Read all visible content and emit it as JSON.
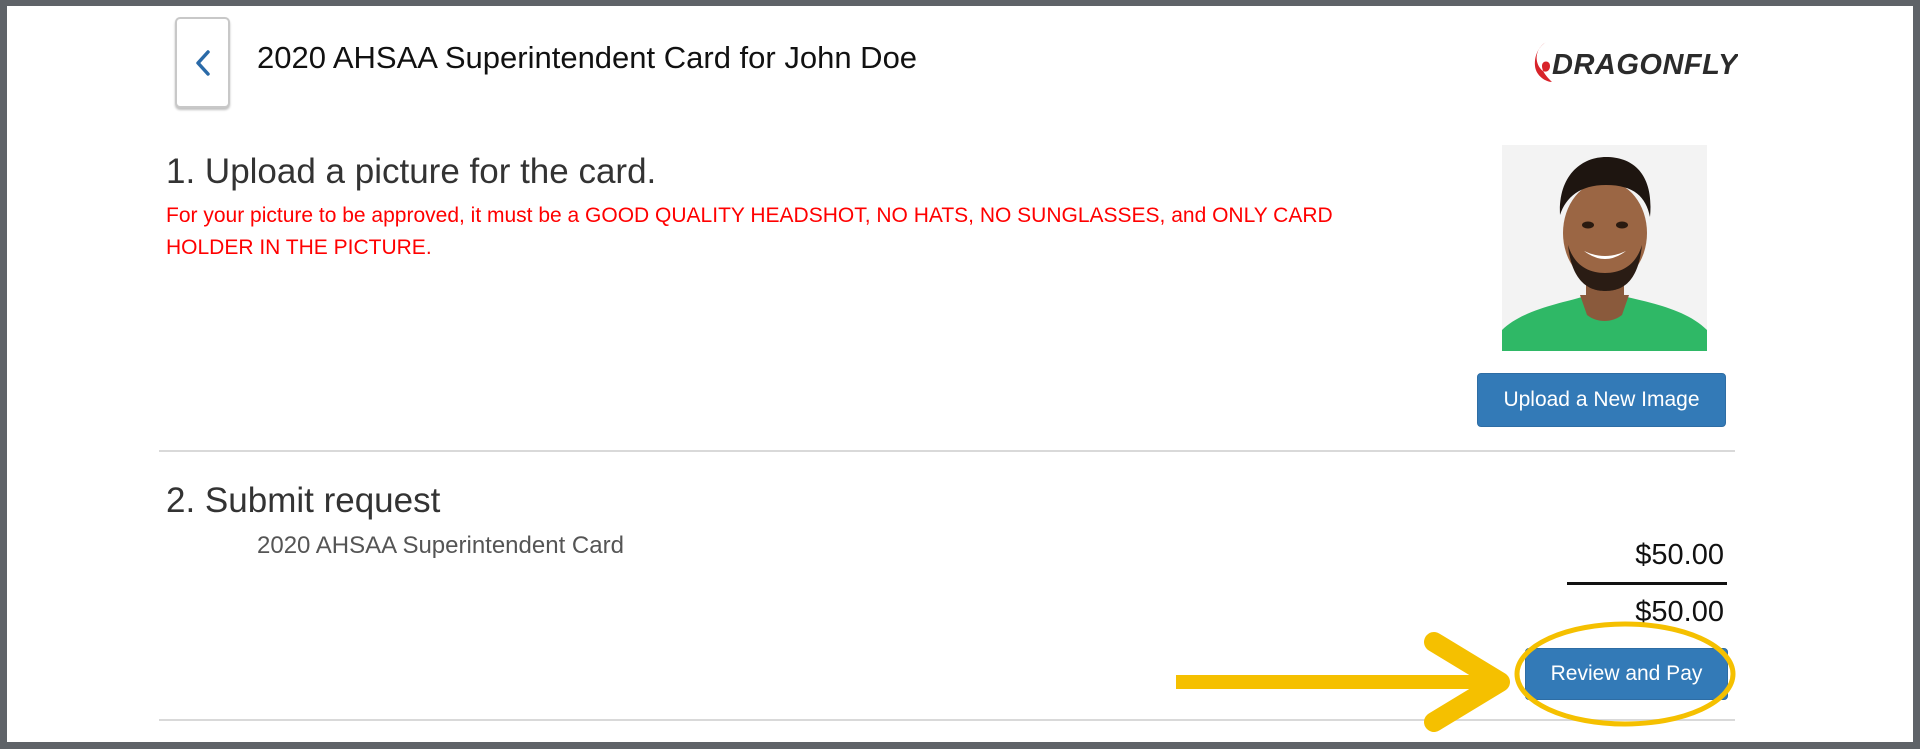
{
  "header": {
    "back_icon": "chevron-left-icon",
    "title": "2020 AHSAA Superintendent Card for John Doe",
    "logo_text": "DRAGONFLY"
  },
  "upload_section": {
    "title": "1. Upload a picture for the card.",
    "warning": "For your picture to be approved, it must be a GOOD QUALITY HEADSHOT, NO HATS, NO SUNGLASSES, and ONLY CARD HOLDER IN THE PICTURE.",
    "upload_button_label": "Upload a New Image"
  },
  "submit_section": {
    "title": "2. Submit request",
    "item_name": "2020 AHSAA Superintendent Card",
    "item_price": "$50.00",
    "total": "$50.00",
    "review_button_label": "Review and Pay"
  },
  "colors": {
    "primary_button": "#337ab7",
    "warning_text": "#ff0000",
    "annotation": "#f5c000",
    "logo_red": "#d8232a"
  }
}
